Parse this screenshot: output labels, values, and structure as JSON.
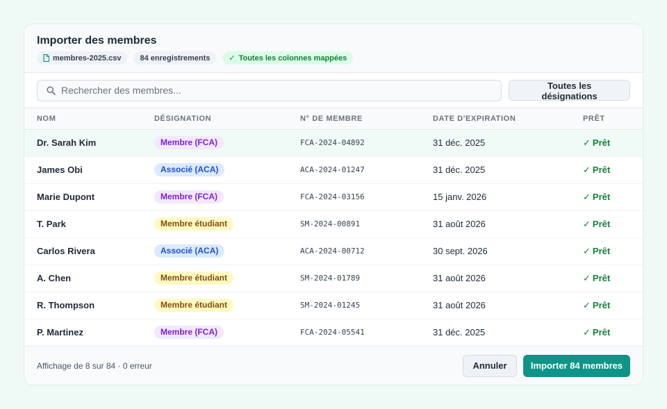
{
  "dialog": {
    "title": "Importer des membres",
    "chips": {
      "file": "membres-2025.csv",
      "records": "84 enregistrements",
      "mapped": "Toutes les colonnes mappées",
      "mapped_icon": "✓"
    }
  },
  "toolbar": {
    "search_placeholder": "Rechercher des membres...",
    "designation_filter": "Toutes les désignations"
  },
  "table": {
    "columns": {
      "name": "NOM",
      "designation": "DÉSIGNATION",
      "number": "N° DE MEMBRE",
      "expiry": "DATE D'EXPIRATION",
      "ready": "PRÊT"
    },
    "rows": [
      {
        "name": "Dr. Sarah Kim",
        "designation": "Membre (FCA)",
        "type": "fca",
        "number": "FCA-2024-04892",
        "expiry": "31 déc. 2025",
        "status": "Prêt",
        "status_icon": "✓"
      },
      {
        "name": "James Obi",
        "designation": "Associé (ACA)",
        "type": "aca",
        "number": "ACA-2024-01247",
        "expiry": "31 déc. 2025",
        "status": "Prêt",
        "status_icon": "✓"
      },
      {
        "name": "Marie Dupont",
        "designation": "Membre (FCA)",
        "type": "fca",
        "number": "FCA-2024-03156",
        "expiry": "15 janv. 2026",
        "status": "Prêt",
        "status_icon": "✓"
      },
      {
        "name": "T. Park",
        "designation": "Membre étudiant",
        "type": "sm",
        "number": "SM-2024-00891",
        "expiry": "31 août 2026",
        "status": "Prêt",
        "status_icon": "✓"
      },
      {
        "name": "Carlos Rivera",
        "designation": "Associé (ACA)",
        "type": "aca",
        "number": "ACA-2024-00712",
        "expiry": "30 sept. 2026",
        "status": "Prêt",
        "status_icon": "✓"
      },
      {
        "name": "A. Chen",
        "designation": "Membre étudiant",
        "type": "sm",
        "number": "SM-2024-01789",
        "expiry": "31 août 2026",
        "status": "Prêt",
        "status_icon": "✓"
      },
      {
        "name": "R. Thompson",
        "designation": "Membre étudiant",
        "type": "sm",
        "number": "SM-2024-01245",
        "expiry": "31 août 2026",
        "status": "Prêt",
        "status_icon": "✓"
      },
      {
        "name": "P. Martinez",
        "designation": "Membre (FCA)",
        "type": "fca",
        "number": "FCA-2024-05541",
        "expiry": "31 déc. 2025",
        "status": "Prêt",
        "status_icon": "✓"
      }
    ]
  },
  "footer": {
    "info": "Affichage de 8 sur 84 · 0 erreur",
    "cancel_label": "Annuler",
    "import_label": "Importer 84 membres"
  },
  "colors": {
    "accent": "#0f9488",
    "ready": "#15803d",
    "fca": "#7e22ce",
    "aca": "#1d4ed8",
    "student": "#854d0e"
  }
}
